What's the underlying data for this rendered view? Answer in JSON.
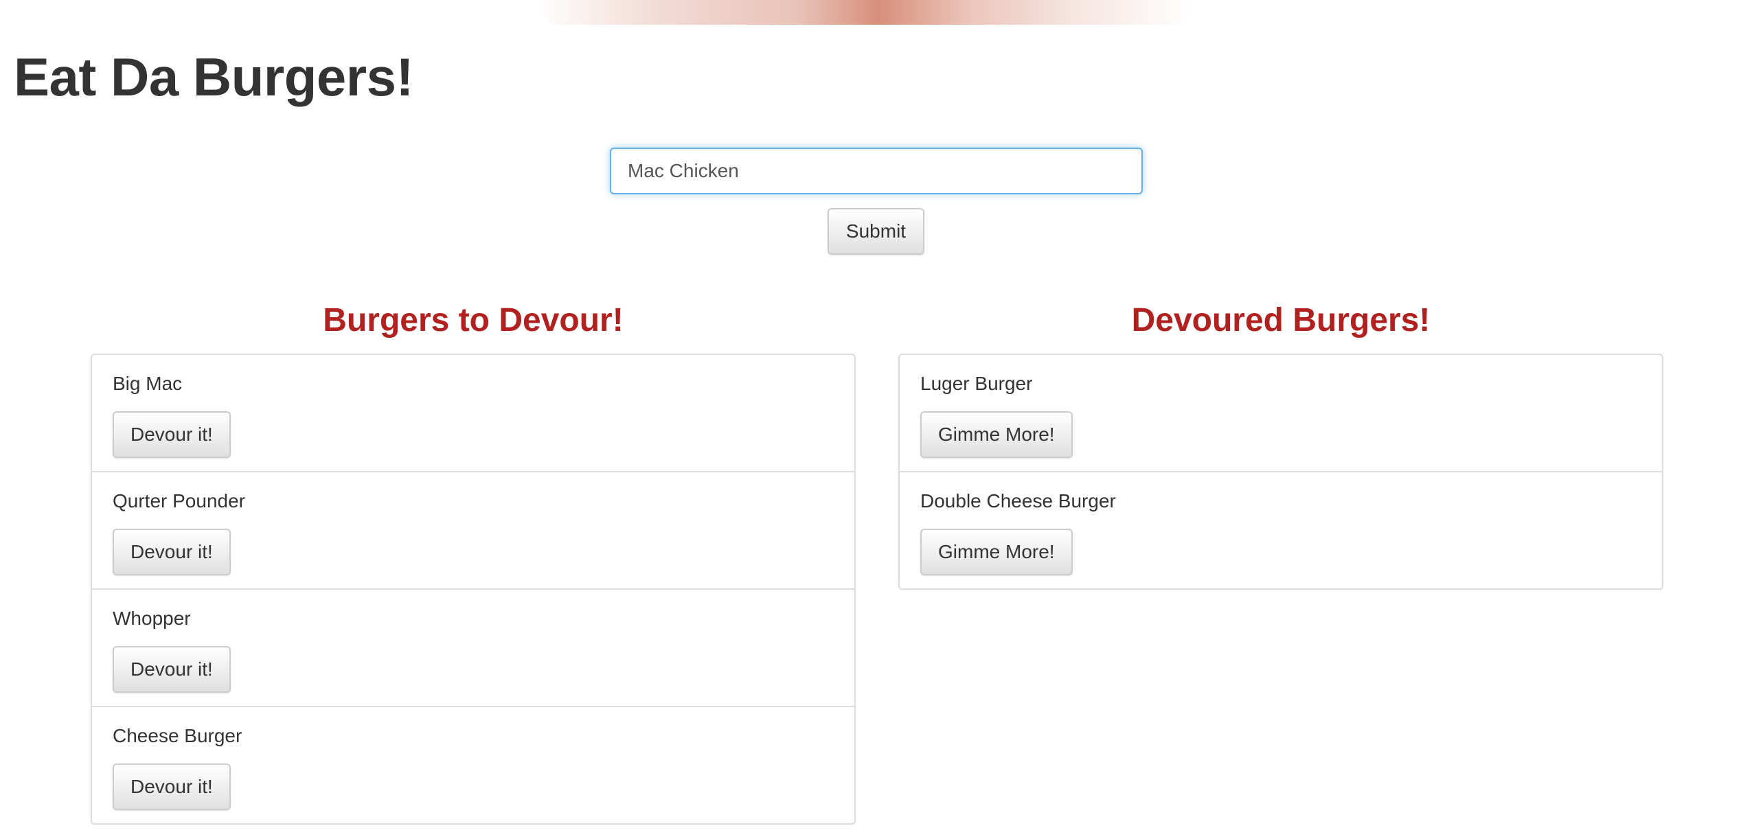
{
  "header": {
    "title": "Eat Da Burgers!"
  },
  "form": {
    "input_value": "Mac Chicken",
    "submit_label": "Submit"
  },
  "to_devour": {
    "title": "Burgers to Devour!",
    "button_label": "Devour it!",
    "items": [
      {
        "name": "Big Mac",
        "button": "Devour it!"
      },
      {
        "name": "Qurter Pounder",
        "button": "Devour it!"
      },
      {
        "name": "Whopper",
        "button": "Devour it!"
      },
      {
        "name": "Cheese Burger",
        "button": "Devour it!"
      }
    ]
  },
  "devoured": {
    "title": "Devoured Burgers!",
    "button_label": "Gimme More!",
    "items": [
      {
        "name": "Luger Burger",
        "button": "Gimme More!"
      },
      {
        "name": "Double Cheese Burger",
        "button": "Gimme More!"
      }
    ]
  },
  "colors": {
    "heading_red": "#b0211f",
    "input_focus": "#66afe9",
    "text": "#333333"
  }
}
